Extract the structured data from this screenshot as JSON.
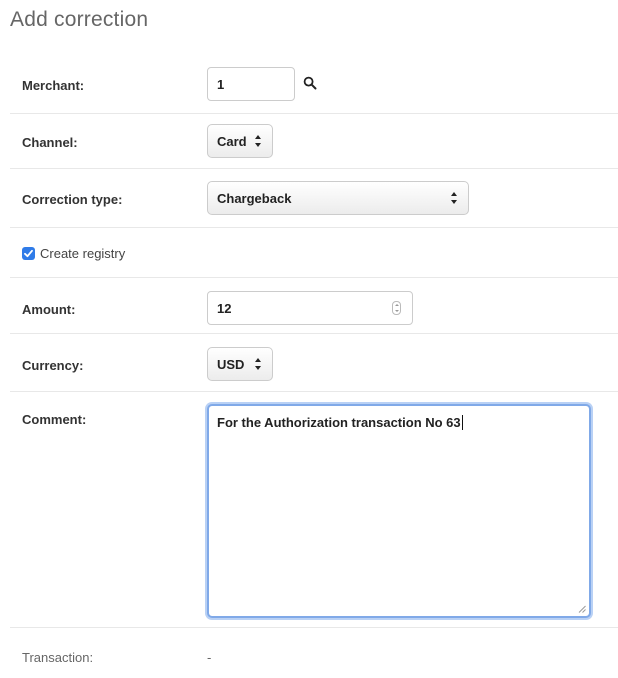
{
  "page": {
    "title": "Add correction"
  },
  "form": {
    "merchant": {
      "label": "Merchant:",
      "value": "1",
      "search_icon": "search-icon"
    },
    "channel": {
      "label": "Channel:",
      "selected": "Card"
    },
    "correction_type": {
      "label": "Correction type:",
      "selected": "Chargeback"
    },
    "create_registry": {
      "label": "Create registry",
      "checked": true,
      "accent_color": "#2f7be8"
    },
    "amount": {
      "label": "Amount:",
      "value": "12"
    },
    "currency": {
      "label": "Currency:",
      "selected": "USD"
    },
    "comment": {
      "label": "Comment:",
      "value": "For the Authorization transaction No 63",
      "focus_color": "#80a9e8"
    },
    "transaction": {
      "label": "Transaction:",
      "value": "-"
    }
  }
}
